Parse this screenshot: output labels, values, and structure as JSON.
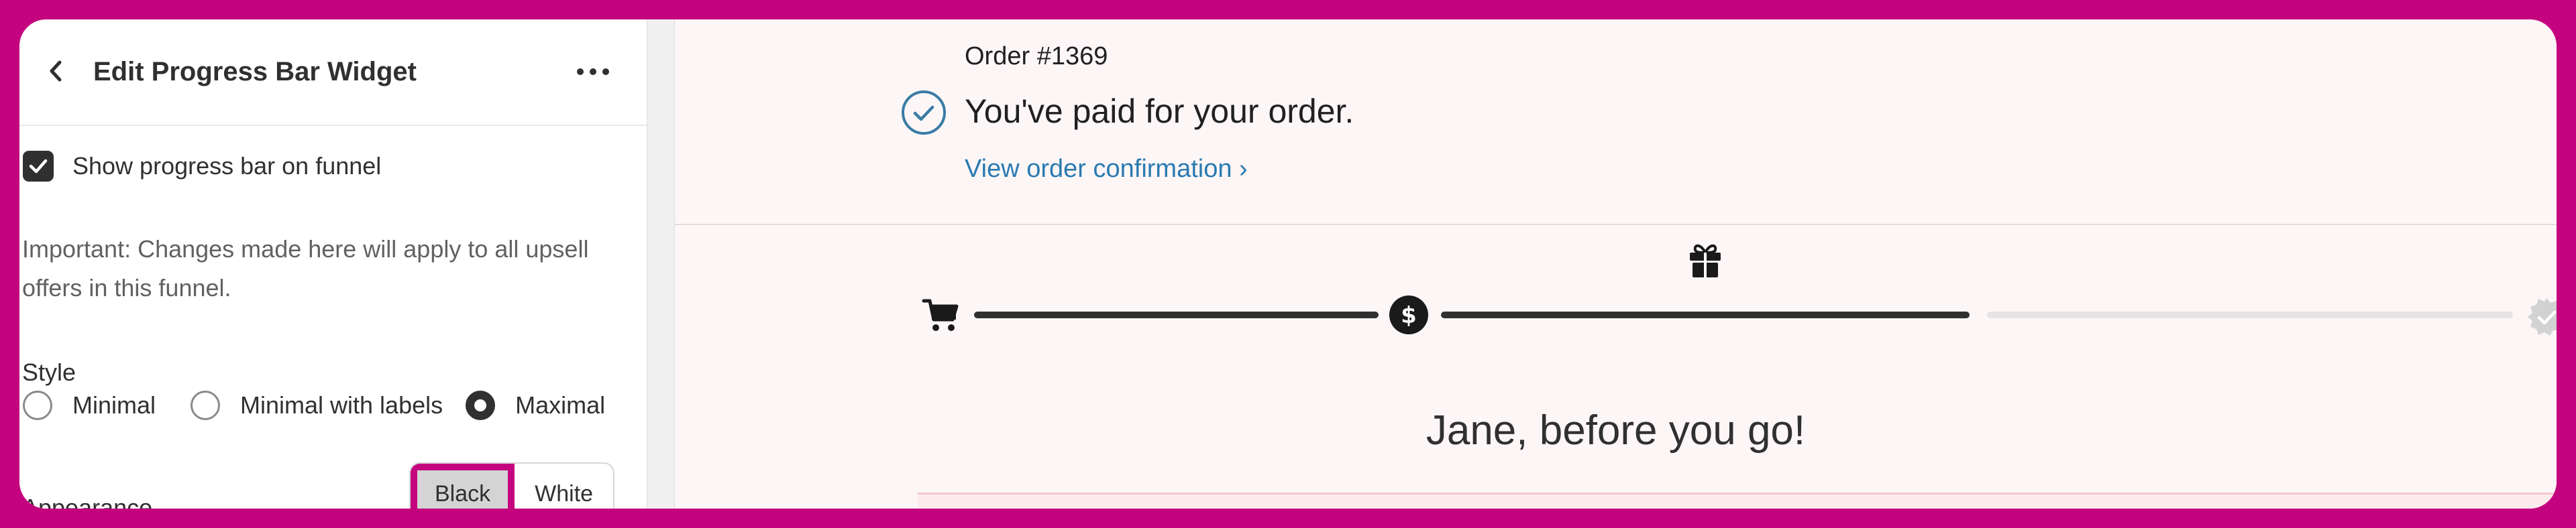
{
  "panel": {
    "title": "Edit Progress Bar Widget",
    "back_icon": "chevron-left-icon",
    "more_icon": "more-horizontal-icon",
    "show_progress": {
      "label": "Show progress bar on funnel",
      "checked": true
    },
    "note": "Important: Changes made here will apply to all upsell offers in this funnel.",
    "style": {
      "label": "Style",
      "options": [
        "Minimal",
        "Minimal with labels",
        "Maximal"
      ],
      "selected": "Maximal"
    },
    "appearance": {
      "label": "Appearance",
      "options": [
        "Black",
        "White"
      ],
      "selected": "Black"
    }
  },
  "preview": {
    "order_number": "Order #1369",
    "paid_text": "You've paid for your order.",
    "confirm_link": "View order confirmation ›",
    "greeting": "Jane, before you go!",
    "progress": {
      "steps": [
        "cart-icon",
        "dollar-icon",
        "gift-icon",
        "verified-badge-icon"
      ],
      "completed_fraction": 0.667
    }
  },
  "colors": {
    "accent_border": "#c4037e",
    "link": "#2a7ab0",
    "progress_active": "#303030",
    "progress_inactive": "#e6e3e4",
    "paid_icon": "#3a7ca5"
  }
}
